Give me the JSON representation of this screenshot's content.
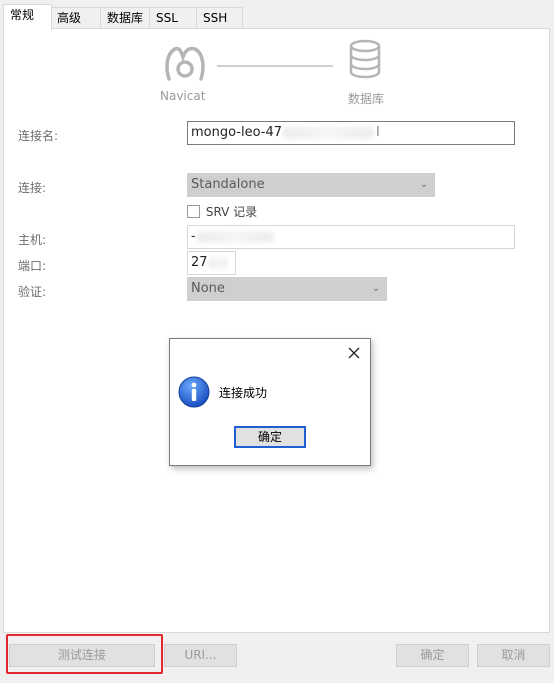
{
  "tabs": [
    "常规",
    "高级",
    "数据库",
    "SSL",
    "SSH"
  ],
  "header": {
    "left_label": "Navicat",
    "right_label": "数据库"
  },
  "form": {
    "conn_name_label": "连接名:",
    "conn_name_value": "mongo-leo-47",
    "conn_name_tail": "I",
    "conn_type_label": "连接:",
    "conn_type_value": "Standalone",
    "srv_label": "SRV 记录",
    "host_label": "主机:",
    "host_value": "-",
    "port_label": "端口:",
    "port_value": "27",
    "auth_label": "验证:",
    "auth_value": "None"
  },
  "dialog": {
    "message": "连接成功",
    "ok_label": "确定"
  },
  "footer": {
    "test_label": "测试连接",
    "uri_label": "URI...",
    "ok_label": "确定",
    "cancel_label": "取消"
  },
  "colors": {
    "highlight": "#e0282e",
    "info_blue": "#1f5fd6"
  }
}
